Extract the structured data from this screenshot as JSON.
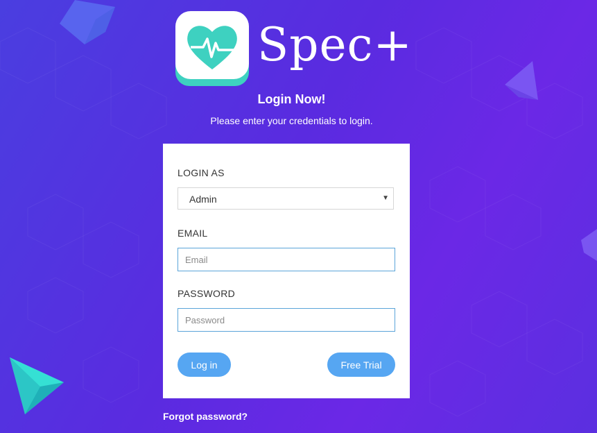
{
  "brand": {
    "name": "Spec+",
    "icon": "heart-pulse-icon"
  },
  "header": {
    "title": "Login Now!",
    "subtitle": "Please enter your credentials to login."
  },
  "form": {
    "login_as_label": "LOGIN AS",
    "login_as_value": "Admin",
    "email_label": "EMAIL",
    "email_placeholder": "Email",
    "email_value": "",
    "password_label": "PASSWORD",
    "password_placeholder": "Password",
    "password_value": "",
    "login_button": "Log in",
    "trial_button": "Free Trial"
  },
  "footer": {
    "forgot_link": "Forgot password?"
  },
  "colors": {
    "background_start": "#4a3ee0",
    "background_end": "#6b28e6",
    "button": "#56a6f2",
    "icon_teal": "#3ed1c0",
    "input_border": "#5aa4d9"
  }
}
